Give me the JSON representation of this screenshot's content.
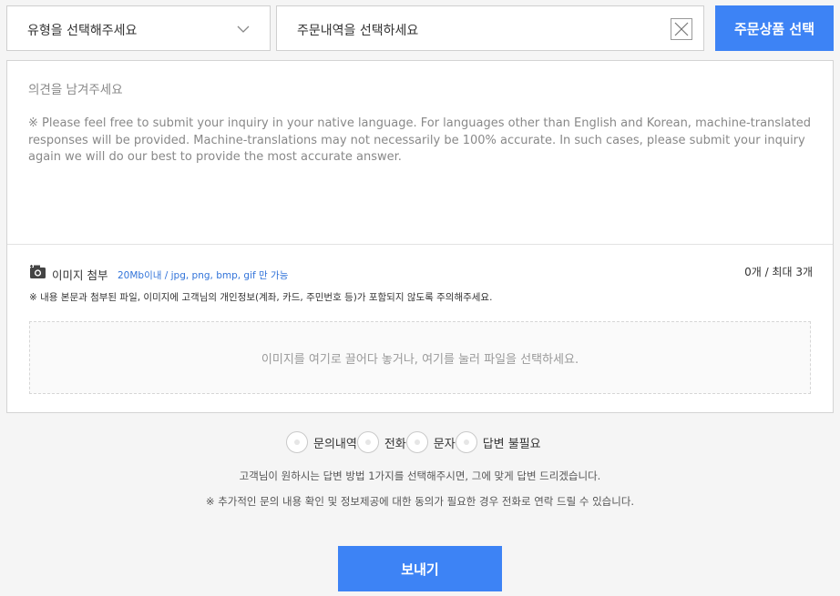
{
  "top": {
    "type_select": {
      "value": "유형을 선택해주세요"
    },
    "order_select": {
      "value": "주문내역을 선택하세요"
    },
    "order_button": "주문상품 선택"
  },
  "comment": {
    "heading": "의견을 남겨주세요",
    "notice": "※ Please feel free to submit your inquiry in your native language. For languages other than English and Korean, machine-translated responses will be provided. Machine-translations may not necessarily be 100% accurate. In such cases, please submit your inquiry again we will do our best to provide the most accurate answer."
  },
  "attachment": {
    "title": "이미지 첨부",
    "limits": "20Mb이내 / jpg, png, bmp, gif 만 가능",
    "count": "0개 / 최대 3개",
    "warning": "※ 내용 본문과 첨부된 파일, 이미지에 고객님의 개인정보(계좌, 카드, 주민번호 등)가 포함되지 않도록 주의해주세요.",
    "dropzone_text": "이미지를 여기로 끌어다 놓거나, 여기를 눌러 파일을 선택하세요."
  },
  "reply_options": [
    {
      "label": "문의내역"
    },
    {
      "label": "전화"
    },
    {
      "label": "문자"
    },
    {
      "label": "답변 불필요"
    }
  ],
  "help": {
    "line1": "고객님이 원하시는 답변 방법 1가지를 선택해주시면, 그에 맞게 답변 드리겠습니다.",
    "line2": "※ 추가적인 문의 내용 확인 및 정보제공에 대한 동의가 필요한 경우 전화로 연락 드릴 수 있습니다."
  },
  "send_button": "보내기",
  "icons": {
    "chevron": "chevron-down-icon",
    "clear": "close-icon",
    "camera": "camera-icon"
  },
  "colors": {
    "accent": "#3d83f5",
    "link": "#3173d9"
  }
}
